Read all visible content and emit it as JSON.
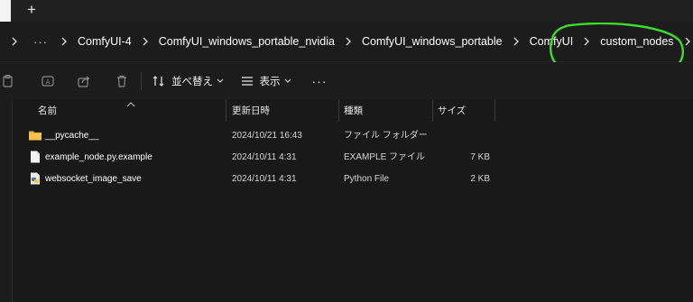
{
  "tabstrip": {
    "new_tab_label": "+"
  },
  "breadcrumb": {
    "overflow_label": "···",
    "items": [
      "ComfyUI-4",
      "ComfyUI_windows_portable_nvidia",
      "ComfyUI_windows_portable",
      "ComfyUI",
      "custom_nodes"
    ]
  },
  "annotation": {
    "color": "#3ddc2c",
    "shape": "circle around custom_nodes"
  },
  "toolbar": {
    "icons": [
      "paste-icon",
      "rename-icon",
      "share-icon",
      "delete-icon"
    ],
    "sort_label": "並べ替え",
    "view_label": "表示",
    "more_label": "···"
  },
  "columns": {
    "name": "名前",
    "modified": "更新日時",
    "type": "種類",
    "size": "サイズ"
  },
  "files": [
    {
      "name": "__pycache__",
      "modified": "2024/10/21 16:43",
      "type": "ファイル フォルダー",
      "size": "",
      "icon": "folder-icon"
    },
    {
      "name": "example_node.py.example",
      "modified": "2024/10/11 4:31",
      "type": "EXAMPLE ファイル",
      "size": "7 KB",
      "icon": "document-icon"
    },
    {
      "name": "websocket_image_save",
      "modified": "2024/10/11 4:31",
      "type": "Python File",
      "size": "2 KB",
      "icon": "python-file-icon"
    }
  ],
  "colors": {
    "background": "#191919",
    "folder": "#f4c24d",
    "accent": "#3ddc2c"
  }
}
